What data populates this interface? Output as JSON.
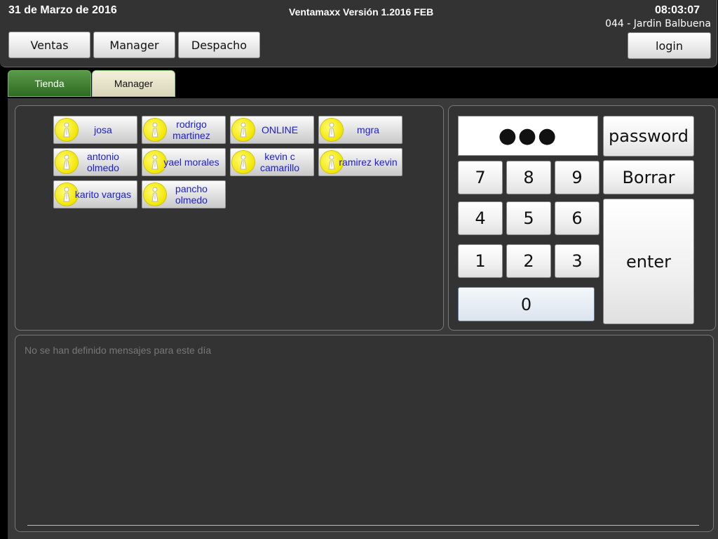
{
  "header": {
    "date": "31 de Marzo de 2016",
    "version": "Ventamaxx Versión 1.2016 FEB",
    "time": "08:03:07",
    "store": "044 - Jardin Balbuena",
    "nav": [
      "Ventas",
      "Manager",
      "Despacho"
    ],
    "login_label": "login"
  },
  "tabs": [
    "Tienda",
    "Manager"
  ],
  "users": [
    "josa",
    "rodrigo martinez",
    "ONLINE",
    "mgra",
    "antonio olmedo",
    "yael morales",
    "kevin c camarillo",
    "ramirez kevin",
    "karito vargas",
    "pancho olmedo"
  ],
  "keypad": {
    "password_mask": "●●●",
    "password_label": "password",
    "clear_label": "Borrar",
    "enter_label": "enter",
    "digits": [
      "7",
      "8",
      "9",
      "4",
      "5",
      "6",
      "1",
      "2",
      "3",
      "0"
    ]
  },
  "messages": {
    "empty_text": "No se han definido mensajes para este día"
  },
  "colors": {
    "user_name": "#1a1ae6",
    "tab_active": "#2e6b22",
    "avatar": "#f2e600"
  }
}
